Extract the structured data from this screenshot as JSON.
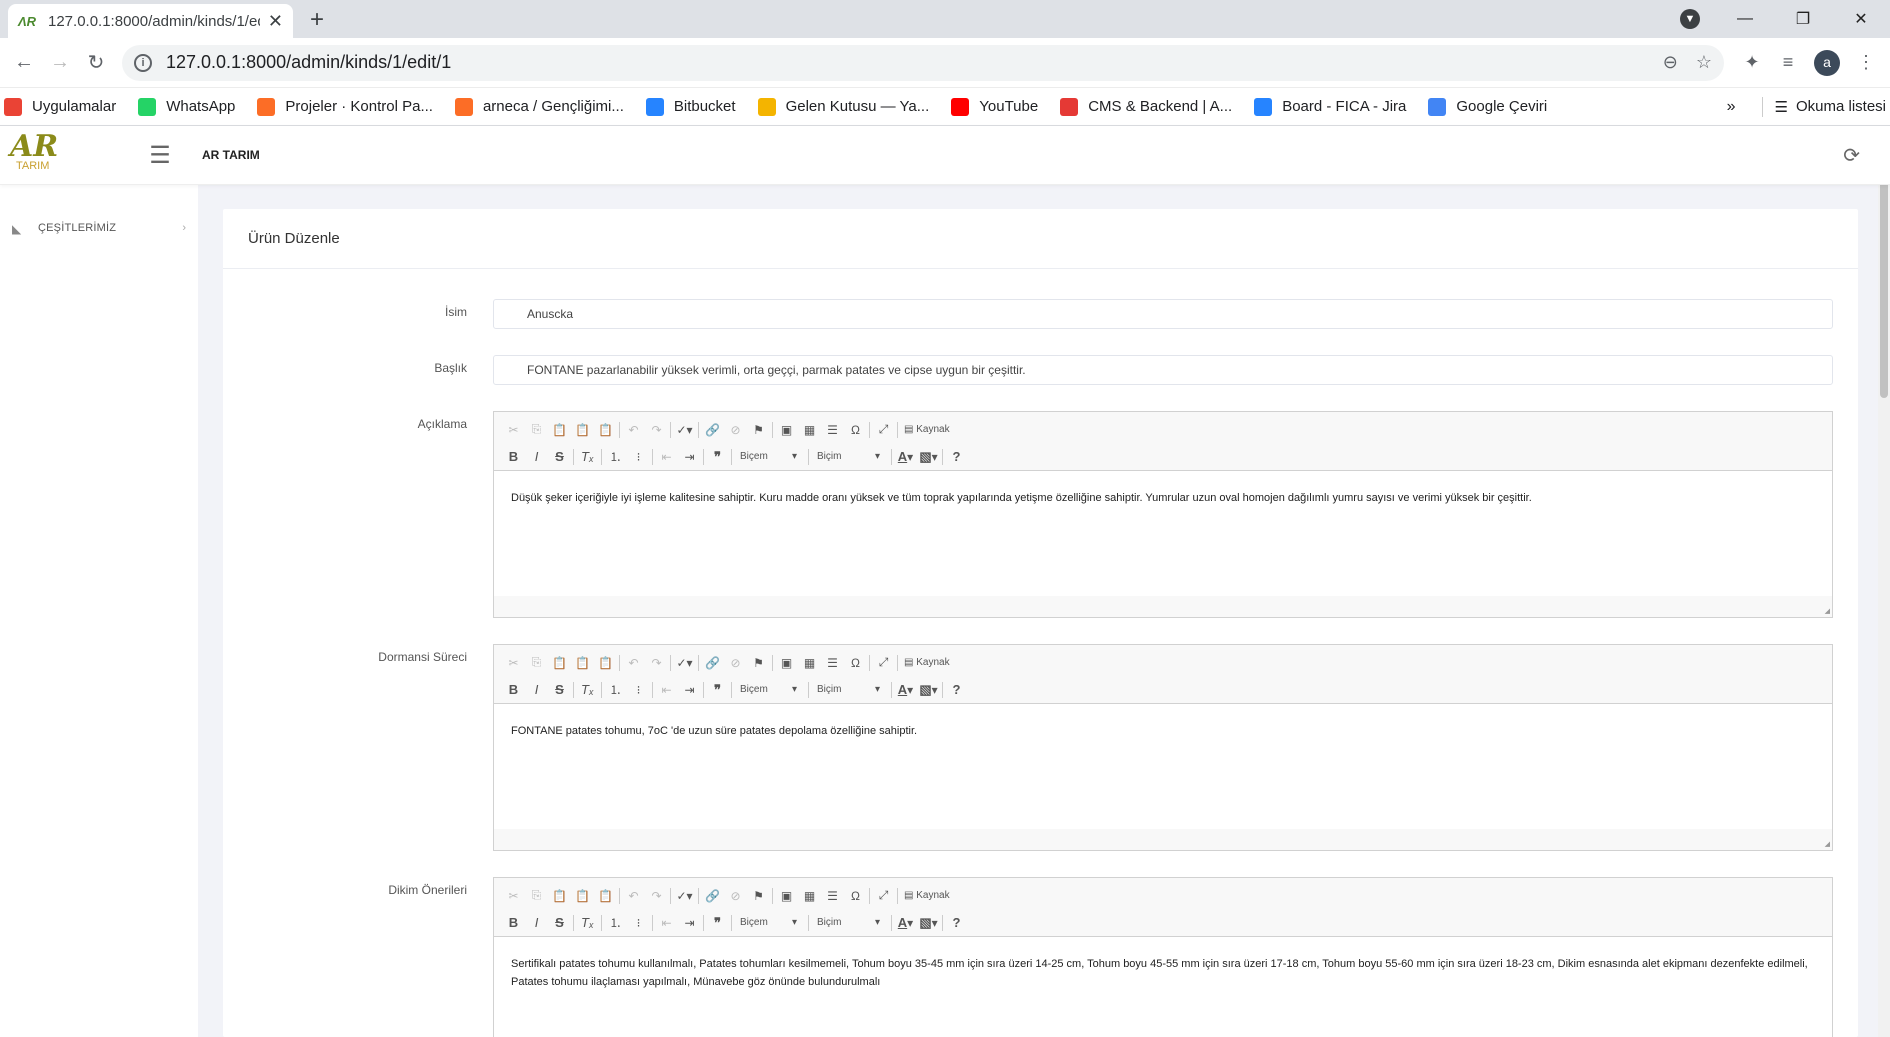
{
  "browser": {
    "tab_title": "127.0.0.1:8000/admin/kinds/1/ed",
    "url": "127.0.0.1:8000/admin/kinds/1/edit/1",
    "avatar_letter": "a",
    "bookmarks": [
      {
        "label": "Uygulamalar",
        "color": "#ea4335"
      },
      {
        "label": "WhatsApp",
        "color": "#25d366"
      },
      {
        "label": "Projeler · Kontrol Pa...",
        "color": "#fc6d26"
      },
      {
        "label": "arneca / Gençliğimi...",
        "color": "#fc6d26"
      },
      {
        "label": "Bitbucket",
        "color": "#2684ff"
      },
      {
        "label": "Gelen Kutusu — Ya...",
        "color": "#f4b400"
      },
      {
        "label": "YouTube",
        "color": "#ff0000"
      },
      {
        "label": "CMS & Backend | A...",
        "color": "#e53935"
      },
      {
        "label": "Board - FICA - Jira",
        "color": "#2684ff"
      },
      {
        "label": "Google Çeviri",
        "color": "#4285f4"
      }
    ],
    "reading_list": "Okuma listesi"
  },
  "app": {
    "brand": "AR TARIM",
    "logo_text": "AR",
    "logo_sub": "TARIM",
    "sidebar": {
      "items": [
        {
          "label": "ÇEŞİTLERİMİZ"
        }
      ]
    },
    "page_title": "Ürün Düzenle"
  },
  "form": {
    "name_label": "İsim",
    "name_value": "Anuscka",
    "title_label": "Başlık",
    "title_value": "FONTANE pazarlanabilir yüksek verimli, orta geççi, parmak patates ve cipse uygun bir çeşittir.",
    "editors": [
      {
        "label": "Açıklama",
        "content": "Düşük şeker içeriğiyle iyi işleme kalitesine sahiptir. Kuru madde oranı yüksek ve tüm toprak yapılarında yetişme özelliğine sahiptir. Yumrular uzun oval homojen dağılımlı yumru sayısı ve verimi yüksek bir çeşittir."
      },
      {
        "label": "Dormansi Süreci",
        "content": "FONTANE patates tohumu, 7oC 'de uzun süre patates depolama özelliğine sahiptir."
      },
      {
        "label": "Dikim Önerileri",
        "content": "Sertifikalı patates tohumu kullanılmalı, Patates tohumları kesilmemeli, Tohum boyu 35-45 mm için sıra üzeri 14-25 cm, Tohum boyu 45-55 mm için sıra üzeri 17-18 cm, Tohum boyu 55-60 mm için sıra üzeri 18-23 cm, Dikim esnasında alet ekipmanı dezenfekte edilmeli, Patates tohumu ilaçlaması yapılmalı, Münavebe göz önünde bulundurulmalı"
      }
    ],
    "toolbar": {
      "source": "Kaynak",
      "style": "Biçem",
      "format": "Biçim"
    }
  }
}
